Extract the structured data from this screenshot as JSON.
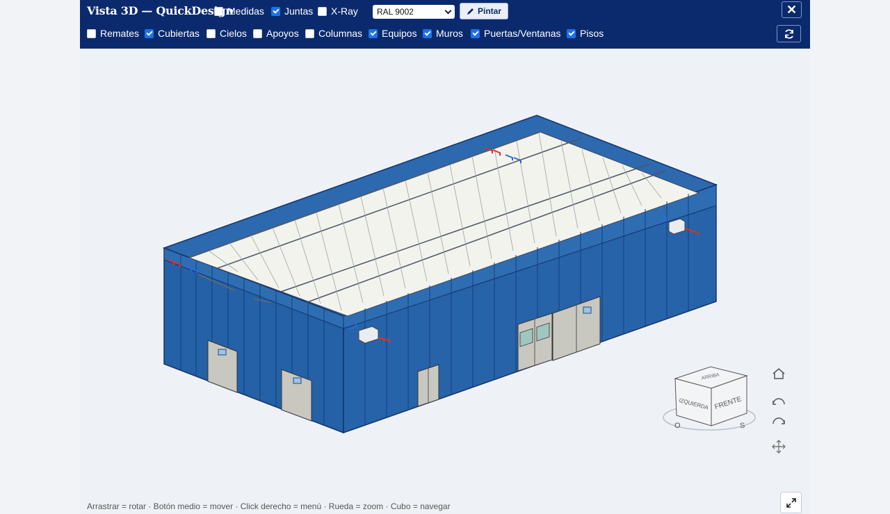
{
  "toolbar": {
    "title": "Vista 3D — QuickDesign",
    "top_options": [
      {
        "label": "Medidas",
        "checked": false
      },
      {
        "label": "Juntas",
        "checked": true
      },
      {
        "label": "X-Ray",
        "checked": false
      }
    ],
    "color_select": {
      "value": "RAL 9002"
    },
    "paint_label": "Pintar",
    "close_label": "✕",
    "layers": [
      {
        "label": "Remates",
        "checked": false
      },
      {
        "label": "Cubiertas",
        "checked": true
      },
      {
        "label": "Cielos",
        "checked": false
      },
      {
        "label": "Apoyos",
        "checked": false
      },
      {
        "label": "Columnas",
        "checked": false
      },
      {
        "label": "Equipos",
        "checked": true
      },
      {
        "label": "Muros",
        "checked": true
      },
      {
        "label": "Puertas/Ventanas",
        "checked": true
      },
      {
        "label": "Pisos",
        "checked": true
      }
    ]
  },
  "view_cube": {
    "top": "ARRIBA",
    "left": "IZQUIERDA",
    "front": "FRENTE",
    "compass_o": "O",
    "compass_s": "S"
  },
  "nav_icons": [
    "home-icon",
    "rotate-left-icon",
    "rotate-right-icon",
    "pan-icon"
  ],
  "status_text": "Arrastrar = rotar · Botón medio = mover · Click derecho = menú · Rueda = zoom · Cubo = navegar",
  "colors": {
    "toolbar_bg": "#0b2a6e",
    "wall": "#2461a6",
    "roof": "#f2f3ec",
    "accent": "#1a73e8"
  }
}
